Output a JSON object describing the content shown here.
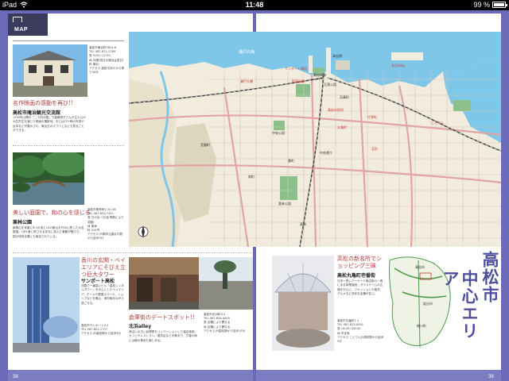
{
  "status": {
    "device": "iPad",
    "time": "11:48",
    "battery": "99 %",
    "battery_level": 0.99
  },
  "header": {
    "tag": "MAP"
  },
  "pages": {
    "left_num": "38",
    "right_num": "39"
  },
  "map": {
    "sea_label": "瀬戸内海",
    "labels": [
      "高松港",
      "高松城跡",
      "JR高松駅",
      "瀬戸大橋",
      "高松市役所",
      "中央公園",
      "栗林公園",
      "北浜alley",
      "兵庫町",
      "片原町",
      "瓦町",
      "中央通り",
      "丸亀町",
      "栗林",
      "サンポート高松",
      "玉藻公園",
      "ことでん",
      "宮脇町",
      "扇町",
      "番町"
    ]
  },
  "sections": {
    "s1": {
      "title": "名作映画の感動を再び!!",
      "name": "高松市庵治観光交流館",
      "body": "1959年公開の『二十四の瞳』で高峰秀子さんが主人公の大石先生を演じた映画の撮影地。中にはロケ時の写真や台本などが展示され、庵治石のオブジェなども見ることができる。",
      "info": "高松市庵治町5824-6\nTEL 087-871-1769\n営 9:00〜17:00\n休 月曜(祝日の場合は翌日)\n料 無料\nアクセス 高松中央ICから車で30分"
    },
    "s2": {
      "title": "美しい庭園で、和の心を感じる",
      "name": "栗林公園",
      "body": "紫雲山を背景に6つの池と13の築山を巧みに配した大名庭園。1歩1景と称される変化に富んだ景観が魅力で、国の特別名勝にも指定されている。",
      "info": "高松市栗林町1-20-16\nTEL 087-833-7411\n営 日の出〜日没(季節により変動)\n休 無休\n料 410円\nアクセス JR栗林公園北口駅から徒歩3分"
    },
    "s3": {
      "title": "香川の玄関・ベイエリアにそびえ立つ巨大タワー",
      "name": "サンポート高松",
      "body": "四国で一番高いビル「高松シンボルタワー」を中心としたベイエリア。ホールや展望スペース、ショップなどを備え、海を眺めながら過ごせる。",
      "info": "高松市サンポート2-1\nTEL 087-822-1707\nアクセス JR高松駅から徒歩3分"
    },
    "s4": {
      "title": "倉庫街のデートスポット!!",
      "name": "北浜alley",
      "body": "港沿いの古い倉庫群をリノベーションした複合施設。カフェやレストラン、雑貨店などが集まり、夕暮れ時には港の景色も楽しめる。",
      "info": "高松市北浜町3-2\nTEL 087-834-4609\n営 店舗により異なる\n休 店舗により異なる\nアクセス JR高松駅から徒歩15分"
    },
    "s5": {
      "title": "高松の新名所でショッピング三昧",
      "name": "高松丸亀町壱番街",
      "body": "日本一長いアーケード商店街の一角にある商業施設。ガラスドームの広場を中心に、ファッションや雑貨、グルメなど多彩な店舗が並ぶ。",
      "info": "高松市丸亀町1-1\nTEL 087-823-0001\n営 10:00〜20:00\n休 不定休\nアクセス ことでん片原町駅から徒歩5分"
    }
  },
  "area_title": {
    "col1": "高松市",
    "col2": "中心エリア"
  },
  "inset": {
    "labels": [
      "高松市",
      "坂出市",
      "綾川町"
    ]
  },
  "colors": {
    "frame": "#6a6ab8",
    "sea": "#7fc7e8",
    "land": "#f1ecde",
    "park": "#8cc08a",
    "rail": "#333333",
    "major_road": "#e1a3a8",
    "title_accent": "#b23a3a",
    "area_title": "#4e4f9f"
  }
}
